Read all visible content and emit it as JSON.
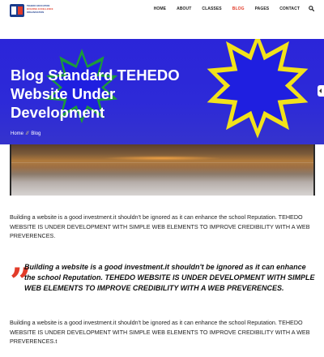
{
  "header": {
    "logo": {
      "line1": "TEHEDO EDUCATION",
      "line2": "BUILDING EXCELLENCE",
      "line3": "ORGANISATION"
    },
    "nav": [
      "HOME",
      "ABOUT",
      "CLASSES",
      "BLOG",
      "PAGES",
      "CONTACT"
    ],
    "active_nav": "BLOG"
  },
  "hero": {
    "title": "Blog Standard TEHEDO Website Under Development",
    "breadcrumb": {
      "home": "Home",
      "separator": "//",
      "current": "Blog"
    }
  },
  "content": {
    "paragraph_1": "Building a website is a good investment.it shouldn't be ignored as it can enhance the school Reputation. TEHEDO WEBSITE IS UNDER DEVELOPMENT WITH SIMPLE WEB ELEMENTS TO IMPROVE CREDIBILITY WITH A WEB PREVERENCES.",
    "quote": "Building a website is a good investment.it shouldn't be ignored as it can enhance the school Reputation. TEHEDO WEBSITE IS UNDER DEVELOPMENT WITH SIMPLE WEB ELEMENTS TO IMPROVE CREDIBILITY WITH A WEB PREVERENCES.",
    "quote_mark": "”",
    "paragraph_2": "Building a website is a good investment.it shouldn't be ignored as it can enhance the school Reputation. TEHEDO WEBSITE IS UNDER DEVELOPMENT WITH SIMPLE WEB ELEMENTS TO IMPROVE CREDIBILITY WITH A WEB PREVERENCES.t"
  },
  "colors": {
    "accent": "#e23c2a",
    "hero_bg": "#2b25d9",
    "star_yellow": "#f2e21a",
    "star_blue": "#1f1fe0",
    "star_green": "#1c9a3b"
  },
  "icons": {
    "search": "search-icon",
    "quote": "quote-icon",
    "slider_tab": "chevron-left-icon"
  }
}
